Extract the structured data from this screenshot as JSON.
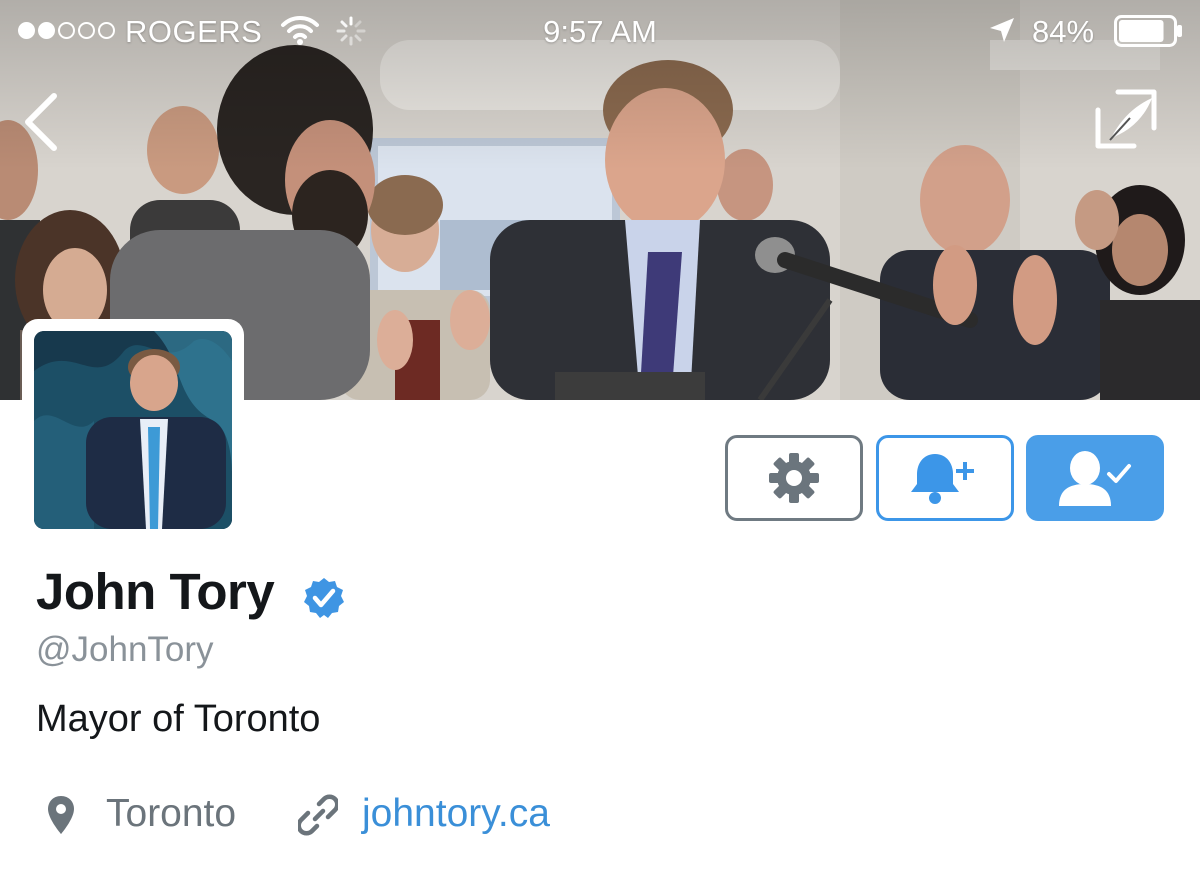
{
  "status_bar": {
    "carrier": "ROGERS",
    "signal_bars_filled": 2,
    "signal_bars_total": 5,
    "time": "9:57 AM",
    "battery_percent": "84%",
    "battery_level": 0.84
  },
  "nav": {
    "back_icon": "chevron-left-icon",
    "compose_icon": "quill-compose-icon"
  },
  "profile": {
    "name": "John Tory",
    "verified": true,
    "handle": "@JohnTory",
    "bio": "Mayor of Toronto",
    "location": "Toronto",
    "website": "johntory.ca"
  },
  "actions": {
    "settings_icon": "gear-icon",
    "notify_icon": "bell-plus-icon",
    "following_icon": "user-check-icon"
  },
  "colors": {
    "accent": "#4a9ee8",
    "link": "#3a8fd8",
    "secondary_text": "#8a9299",
    "primary_text": "#14171a"
  }
}
